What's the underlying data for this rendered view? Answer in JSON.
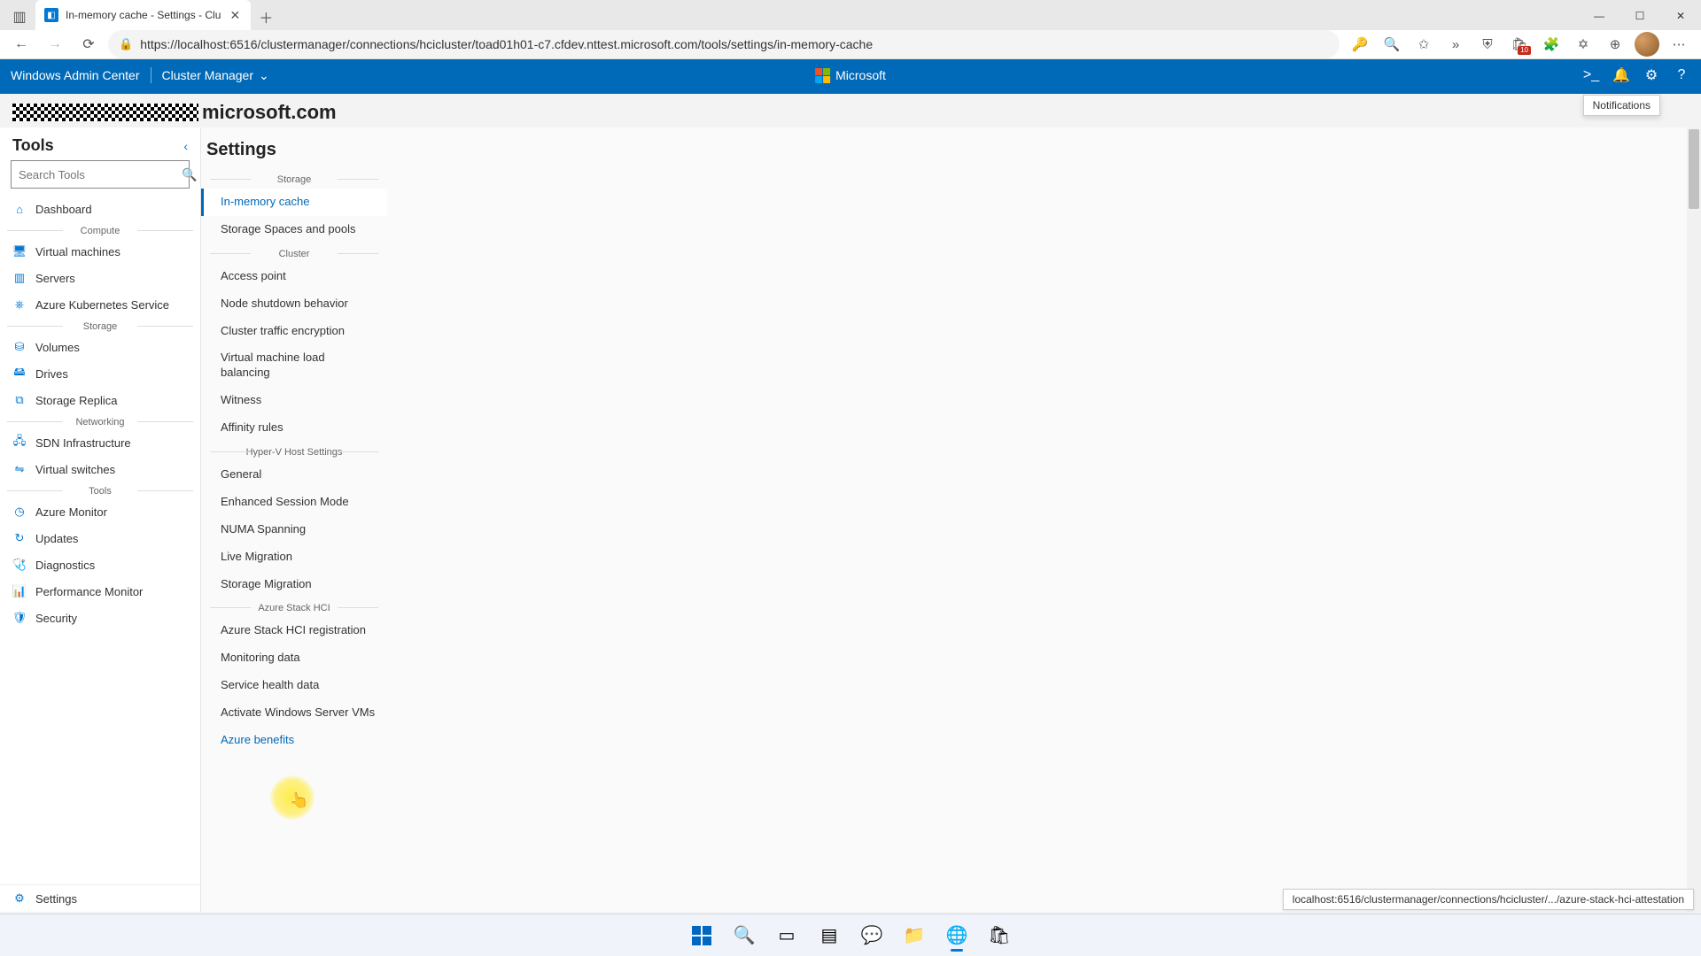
{
  "browser": {
    "tab_title": "In-memory cache - Settings - Clu",
    "url": "https://localhost:6516/clustermanager/connections/hcicluster/toad01h01-c7.cfdev.nttest.microsoft.com/tools/settings/in-memory-cache"
  },
  "wac": {
    "brand": "Windows Admin Center",
    "context": "Cluster Manager",
    "ms_label": "Microsoft",
    "notifications_tooltip": "Notifications"
  },
  "host": {
    "suffix": "microsoft.com"
  },
  "tools": {
    "title": "Tools",
    "search_placeholder": "Search Tools",
    "groups": [
      {
        "items": [
          {
            "icon": "home-icon",
            "label": "Dashboard"
          }
        ]
      },
      {
        "name": "Compute",
        "items": [
          {
            "icon": "vm-icon",
            "label": "Virtual machines"
          },
          {
            "icon": "server-icon",
            "label": "Servers"
          },
          {
            "icon": "aks-icon",
            "label": "Azure Kubernetes Service"
          }
        ]
      },
      {
        "name": "Storage",
        "items": [
          {
            "icon": "volume-icon",
            "label": "Volumes"
          },
          {
            "icon": "drive-icon",
            "label": "Drives"
          },
          {
            "icon": "replica-icon",
            "label": "Storage Replica"
          }
        ]
      },
      {
        "name": "Networking",
        "items": [
          {
            "icon": "sdn-icon",
            "label": "SDN Infrastructure"
          },
          {
            "icon": "vswitch-icon",
            "label": "Virtual switches"
          }
        ]
      },
      {
        "name": "Tools",
        "items": [
          {
            "icon": "monitor-icon",
            "label": "Azure Monitor"
          },
          {
            "icon": "updates-icon",
            "label": "Updates"
          },
          {
            "icon": "diag-icon",
            "label": "Diagnostics"
          },
          {
            "icon": "perf-icon",
            "label": "Performance Monitor"
          },
          {
            "icon": "security-icon",
            "label": "Security"
          }
        ]
      }
    ],
    "settings_label": "Settings"
  },
  "settings": {
    "title": "Settings",
    "groups": [
      {
        "name": "Storage",
        "items": [
          {
            "label": "In-memory cache",
            "active": true
          },
          {
            "label": "Storage Spaces and pools"
          }
        ]
      },
      {
        "name": "Cluster",
        "items": [
          {
            "label": "Access point"
          },
          {
            "label": "Node shutdown behavior"
          },
          {
            "label": "Cluster traffic encryption"
          },
          {
            "label": "Virtual machine load balancing"
          },
          {
            "label": "Witness"
          },
          {
            "label": "Affinity rules"
          }
        ]
      },
      {
        "name": "Hyper-V Host Settings",
        "items": [
          {
            "label": "General"
          },
          {
            "label": "Enhanced Session Mode"
          },
          {
            "label": "NUMA Spanning"
          },
          {
            "label": "Live Migration"
          },
          {
            "label": "Storage Migration"
          }
        ]
      },
      {
        "name": "Azure Stack HCI",
        "items": [
          {
            "label": "Azure Stack HCI registration"
          },
          {
            "label": "Monitoring data"
          },
          {
            "label": "Service health data"
          },
          {
            "label": "Activate Windows Server VMs"
          },
          {
            "label": "Azure benefits",
            "hovered": true
          }
        ]
      }
    ]
  },
  "status_url": "localhost:6516/clustermanager/connections/hcicluster/.../azure-stack-hci-attestation"
}
